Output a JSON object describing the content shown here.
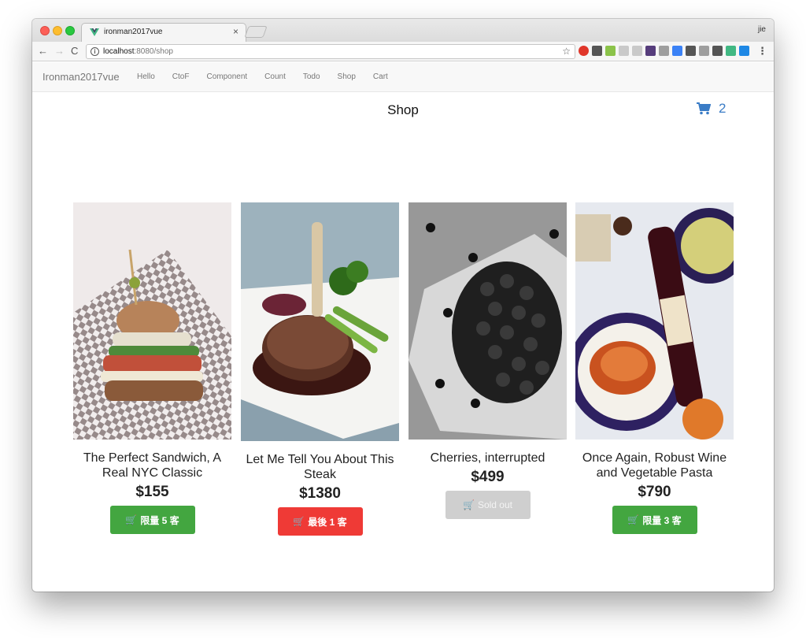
{
  "browser": {
    "tab_title": "ironman2017vue",
    "tab_close": "×",
    "profile": "jie",
    "url_host": "localhost",
    "url_path": ":8080/shop",
    "info_glyph": "i",
    "back_glyph": "←",
    "forward_glyph": "→",
    "reload_glyph": "C",
    "star_glyph": "☆",
    "menu_glyph": "⋮",
    "extension_colors": [
      "#e0362a",
      "#555555",
      "#8bc34a",
      "#c9c9c9",
      "#c9c9c9",
      "#563d7c",
      "#9e9e9e",
      "#3b82f6",
      "#555555",
      "#9e9e9e",
      "#555555",
      "#41b883",
      "#1e88e5"
    ]
  },
  "navbar": {
    "brand": "Ironman2017vue",
    "links": [
      "Hello",
      "CtoF",
      "Component",
      "Count",
      "Todo",
      "Shop",
      "Cart"
    ]
  },
  "page": {
    "title": "Shop"
  },
  "cart": {
    "count": "2",
    "icon": "cart-icon",
    "color": "#3a7cc6"
  },
  "products": [
    {
      "name": "The Perfect Sandwich, A Real NYC Classic",
      "price": "$155",
      "button": "限量 5 客",
      "status": "limited",
      "color": "#43a640"
    },
    {
      "name": "Let Me Tell You About This Steak",
      "price": "$1380",
      "button": "最後 1 客",
      "status": "last",
      "color": "#ef3a36"
    },
    {
      "name": "Cherries, interrupted",
      "price": "$499",
      "button": "Sold out",
      "status": "sold-out",
      "color": "#cfcfcf"
    },
    {
      "name": "Once Again, Robust Wine and Vegetable Pasta",
      "price": "$790",
      "button": "限量 3 客",
      "status": "limited",
      "color": "#43a640"
    }
  ]
}
